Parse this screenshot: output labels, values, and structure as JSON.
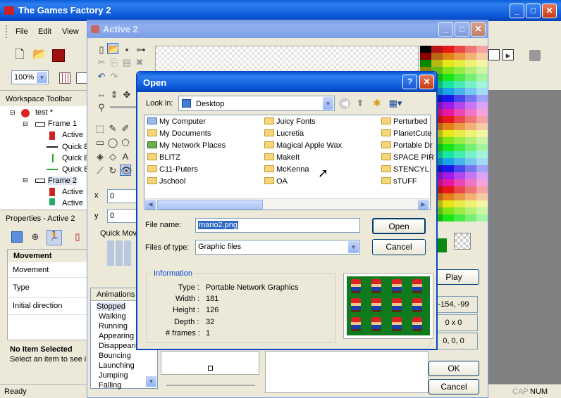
{
  "main_window": {
    "title": "The Games Factory 2",
    "menu": [
      "File",
      "Edit",
      "View"
    ],
    "zoom": "100%"
  },
  "workspace": {
    "title": "Workspace Toolbar",
    "tree": [
      "test *",
      "Frame 1",
      "Active",
      "Quick B",
      "Quick B",
      "Quick B",
      "Frame 2",
      "Active",
      "Active"
    ]
  },
  "properties": {
    "title": "Properties - Active 2",
    "section": "Movement",
    "rows": [
      "Movement",
      "Type",
      "Initial direction"
    ],
    "footer_title": "No Item Selected",
    "footer_text": "Select an item to see i"
  },
  "status": {
    "ready": "Ready",
    "cap": "CAP",
    "num": "NUM"
  },
  "editor": {
    "title": "Active 2",
    "x_label": "x",
    "x_value": "0",
    "y_label": "y",
    "y_value": "0",
    "quick_move": "Quick Mov",
    "animations_header": "Animations",
    "animations": [
      "Stopped",
      "Walking",
      "Running",
      "Appearing",
      "Disappearin",
      "Bouncing",
      "Launching",
      "Jumping",
      "Falling"
    ],
    "play": "Play",
    "coords": "-154, -99",
    "size": "0 x 0",
    "hotspot": "0, 0, 0",
    "ok": "OK",
    "cancel": "Cancel"
  },
  "dialog": {
    "title": "Open",
    "lookin_label": "Look in:",
    "lookin_value": "Desktop",
    "files_col1": [
      "My Computer",
      "My Documents",
      "My Network Places",
      "BLITZ",
      "C11-Puters",
      "Jschool"
    ],
    "files_col2": [
      "Juicy Fonts",
      "Lucretia",
      "Magical Apple Wax",
      "MakeIt",
      "McKenna",
      "OA"
    ],
    "files_col3": [
      "Perturbed",
      "PlanetCute",
      "Portable Dr",
      "SPACE PIR",
      "STENCYL",
      "sTUFF"
    ],
    "filename_label": "File name:",
    "filename_value": "mario2.png",
    "filetype_label": "Files of type:",
    "filetype_value": "Graphic files",
    "open": "Open",
    "cancel": "Cancel",
    "info_title": "Information",
    "info_labels": [
      "Type :",
      "Width :",
      "Height :",
      "Depth :",
      "# frames :"
    ],
    "info_values": [
      "Portable Network Graphics",
      "181",
      "126",
      "32",
      "1"
    ]
  }
}
